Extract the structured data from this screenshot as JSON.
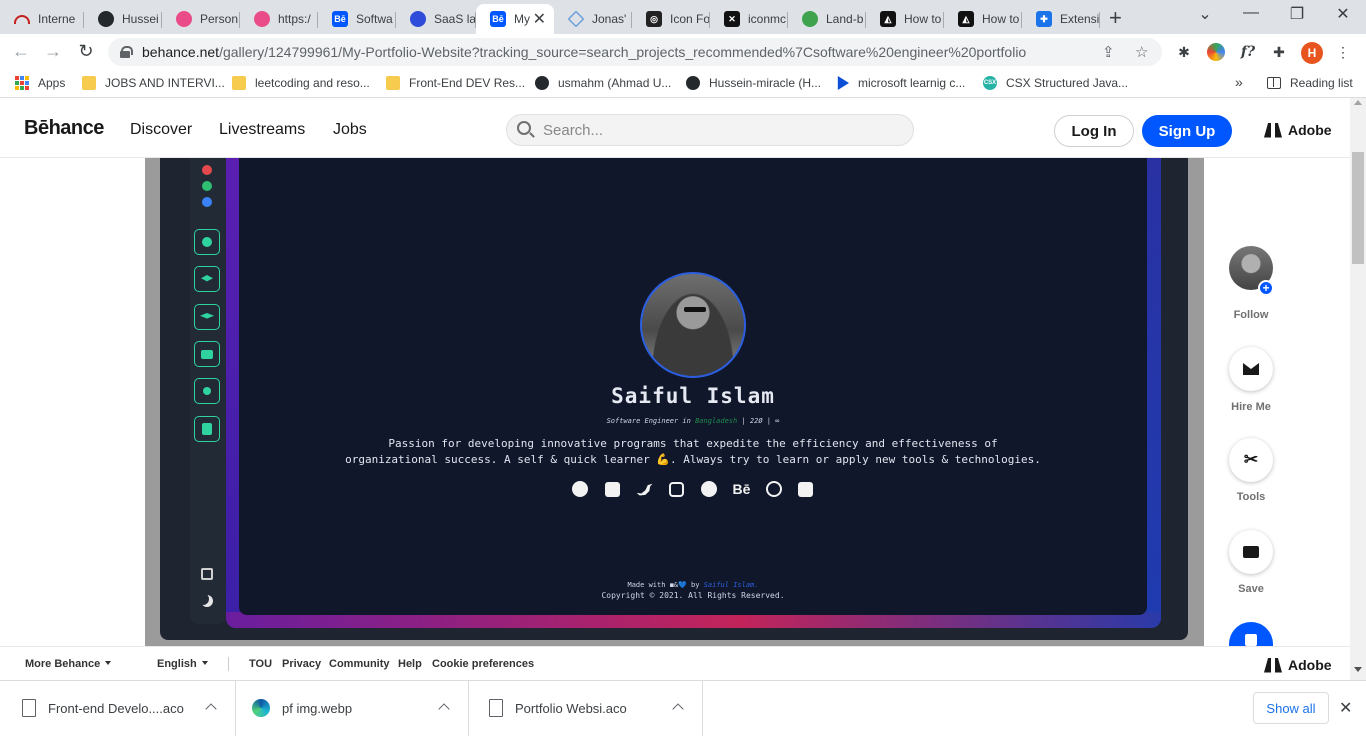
{
  "browser": {
    "tabs": [
      {
        "label": "Interne",
        "icon": "internet-archive-icon",
        "color": "#c5221f"
      },
      {
        "label": "Hussei",
        "icon": "github-icon",
        "color": "#24292e"
      },
      {
        "label": "Person",
        "icon": "dribbble-icon",
        "color": "#ea4c89"
      },
      {
        "label": "https:/",
        "icon": "dribbble-icon",
        "color": "#ea4c89"
      },
      {
        "label": "Softwa",
        "icon": "behance-icon",
        "color": "#0057ff"
      },
      {
        "label": "SaaS la",
        "icon": "saas-icon",
        "color": "#2e4bd9"
      },
      {
        "label": "My",
        "icon": "behance-icon",
        "color": "#0057ff",
        "active": true
      },
      {
        "label": "Jonas'",
        "icon": "diamond-icon",
        "color": "#6aa0d8"
      },
      {
        "label": "Icon Fo",
        "icon": "iconfont-icon",
        "color": "#222222"
      },
      {
        "label": "iconmc",
        "icon": "iconmonstr-icon",
        "color": "#111111"
      },
      {
        "label": "Land-b",
        "icon": "landbot-icon",
        "color": "#3fa34d"
      },
      {
        "label": "How to",
        "icon": "tiktok-icon",
        "color": "#111111"
      },
      {
        "label": "How to",
        "icon": "tiktok-icon",
        "color": "#111111"
      },
      {
        "label": "Extensi",
        "icon": "puzzle-icon",
        "color": "#1a73e8"
      }
    ],
    "url_main": "behance.net",
    "url_rest": "/gallery/124799961/My-Portfolio-Website?tracking_source=search_projects_recommended%7Csoftware%20engineer%20portfolio",
    "profile_initial": "H",
    "bookmarks": [
      {
        "label": "Apps",
        "icon": "apps-grid-icon"
      },
      {
        "label": "JOBS AND INTERVI...",
        "icon": "folder-icon"
      },
      {
        "label": "leetcoding and reso...",
        "icon": "folder-icon"
      },
      {
        "label": "Front-End DEV Res...",
        "icon": "folder-icon"
      },
      {
        "label": "usmahm (Ahmad U...",
        "icon": "github-icon"
      },
      {
        "label": "Hussein-miracle (H...",
        "icon": "github-icon"
      },
      {
        "label": "microsoft learnig c...",
        "icon": "microsoft-learn-icon"
      },
      {
        "label": "CSX Structured Java...",
        "icon": "csx-icon"
      }
    ],
    "bookmarks_more": "»",
    "reading_list": "Reading list"
  },
  "behance": {
    "logo": "Bēhance",
    "nav": [
      "Discover",
      "Livestreams",
      "Jobs"
    ],
    "search_placeholder": "Search...",
    "login": "Log In",
    "signup": "Sign Up",
    "adobe": "Adobe"
  },
  "portfolio": {
    "name": "Saiful Islam",
    "role_prefix": "Software Engineer in",
    "role_location": "Bangladesh",
    "role_suffix": "| 22Ø | ∞",
    "bio": "Passion for developing innovative programs that expedite the efficiency and effectiveness of organizational success. A self & quick learner 💪. Always try to learn or apply new tools & technologies.",
    "socials": [
      "github-icon",
      "linkedin-icon",
      "twitter-icon",
      "instagram-icon",
      "facebook-icon",
      "behance-icon",
      "dribbble-icon",
      "flickr-icon"
    ],
    "behance_glyph": "Bē",
    "made_prefix": "Made with",
    "made_icons": "◼&💙",
    "made_by": "by",
    "made_author": "Saiful Islam.",
    "copyright": "Copyright © 2021. All Rights Reserved."
  },
  "rail": {
    "follow": "Follow",
    "hire": "Hire Me",
    "tools": "Tools",
    "save": "Save"
  },
  "footer": {
    "more": "More Behance",
    "language": "English",
    "links": [
      "TOU",
      "Privacy",
      "Community",
      "Help",
      "Cookie preferences"
    ],
    "adobe": "Adobe"
  },
  "downloads": [
    {
      "name": "Front-end Develo....aco",
      "icon": "file-icon"
    },
    {
      "name": "pf img.webp",
      "icon": "edge-icon"
    },
    {
      "name": "Portfolio Websi.aco",
      "icon": "file-icon"
    }
  ],
  "show_all": "Show all"
}
